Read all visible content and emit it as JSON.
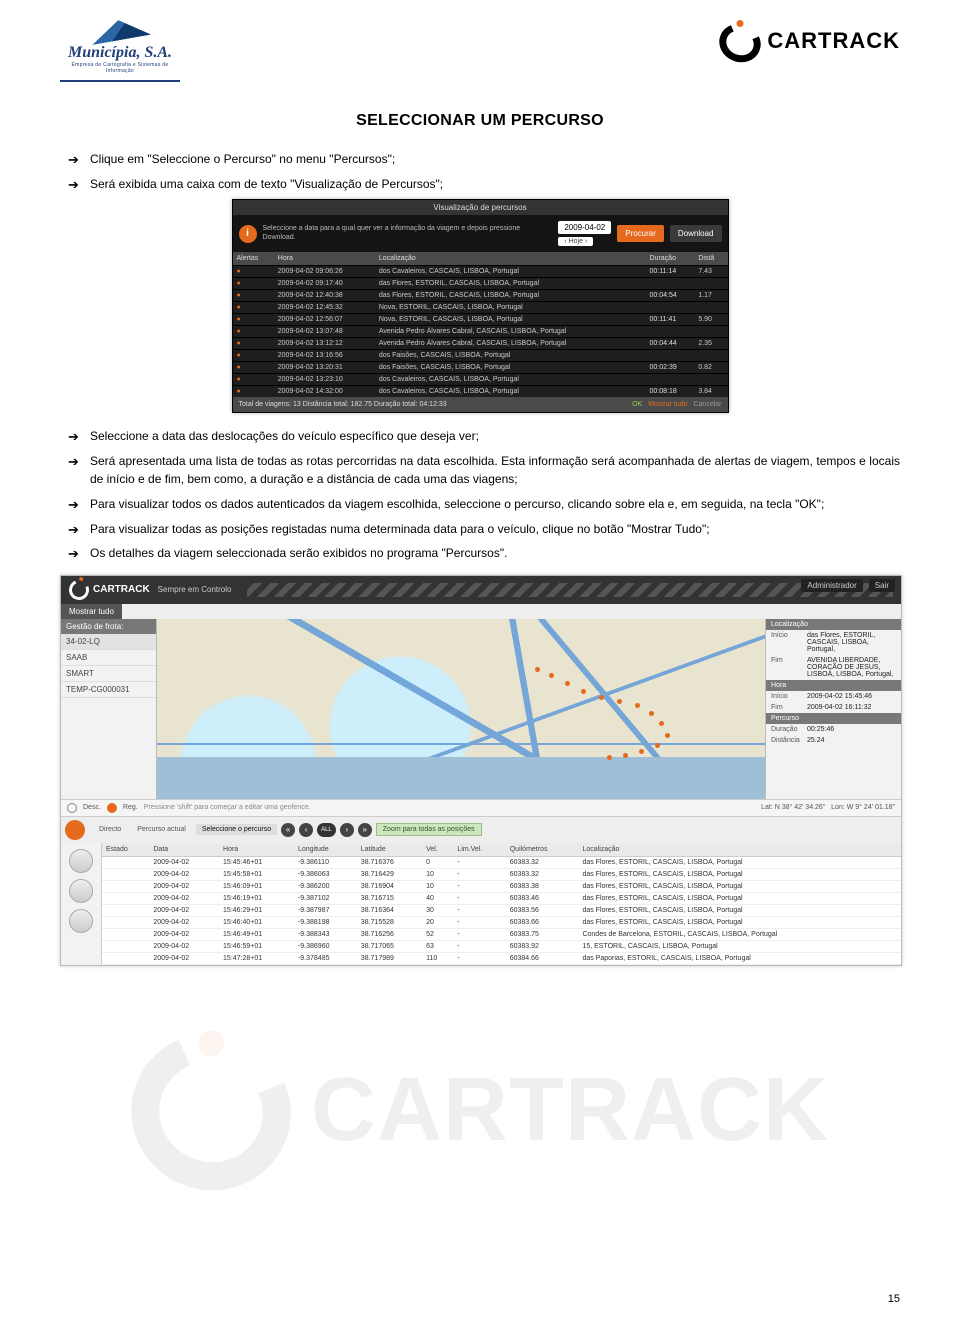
{
  "header": {
    "municipia_name": "Municípia, S.A.",
    "municipia_sub": "Empresa de Cartografia e Sistemas de Informação",
    "cartrack": "CARTRACK"
  },
  "title": "SELECCIONAR UM PERCURSO",
  "bullets_a": [
    "Clique em \"Seleccione o Percurso\" no menu \"Percursos\";",
    "Será exibida uma caixa com de texto \"Visualização de Percursos\";"
  ],
  "bullets_b": [
    "Seleccione a data das deslocações do veículo específico que deseja ver;",
    "Será apresentada uma lista de todas as rotas percorridas na data escolhida. Esta informação será acompanhada de alertas de viagem, tempos e locais de início e de fim, bem como, a duração e a distância de cada uma das viagens;",
    "Para visualizar todos os dados autenticados da viagem escolhida, seleccione o percurso, clicando sobre ela e, em seguida, na tecla \"OK\";",
    "Para visualizar todas as posições registadas numa determinada data para o veículo, clique no botão \"Mostrar Tudo\";",
    "Os detalhes da viagem seleccionada serão exibidos no programa \"Percursos\"."
  ],
  "shot1": {
    "title": "Visualização de percursos",
    "hint": "Seleccione a data para a qual quer ver a informação da viagem e depois pressione Download.",
    "date": "2009-04-02",
    "hoje": "‹ Hoje ›",
    "procurar": "Procurar",
    "download": "Download",
    "cols": [
      "Alertas",
      "Hora",
      "Localização",
      "Duração",
      "Distâ"
    ],
    "rows": [
      {
        "h": "2009-04-02 09:06:26",
        "l": "dos Cavaleiros, CASCAIS, LISBOA, Portugal",
        "d": "00:11:14",
        "k": "7.43"
      },
      {
        "h": "2009-04-02 09:17:40",
        "l": "das Flores, ESTORIL, CASCAIS, LISBOA, Portugal",
        "d": "",
        "k": ""
      },
      {
        "h": "2009-04-02 12:40:38",
        "l": "das Flores, ESTORIL, CASCAIS, LISBOA, Portugal",
        "d": "00:04:54",
        "k": "1.17"
      },
      {
        "h": "2009-04-02 12:45:32",
        "l": "Nova, ESTORIL, CASCAIS, LISBOA, Portugal",
        "d": "",
        "k": ""
      },
      {
        "h": "2009-04-02 12:56:07",
        "l": "Nova, ESTORIL, CASCAIS, LISBOA, Portugal",
        "d": "00:11:41",
        "k": "5.90"
      },
      {
        "h": "2009-04-02 13:07:48",
        "l": "Avenida Pedro Álvares Cabral, CASCAIS, LISBOA, Portugal",
        "d": "",
        "k": ""
      },
      {
        "h": "2009-04-02 13:12:12",
        "l": "Avenida Pedro Álvares Cabral, CASCAIS, LISBOA, Portugal",
        "d": "00:04:44",
        "k": "2.35"
      },
      {
        "h": "2009-04-02 13:16:56",
        "l": "dos Faisões, CASCAIS, LISBOA, Portugal",
        "d": "",
        "k": ""
      },
      {
        "h": "2009-04-02 13:20:31",
        "l": "dos Faisões, CASCAIS, LISBOA, Portugal",
        "d": "00:02:39",
        "k": "0.82"
      },
      {
        "h": "2009-04-02 13:23:10",
        "l": "dos Cavaleiros, CASCAIS, LISBOA, Portugal",
        "d": "",
        "k": ""
      },
      {
        "h": "2009-04-02 14:32:00",
        "l": "dos Cavaleiros, CASCAIS, LISBOA, Portugal",
        "d": "00:08:18",
        "k": "3.84"
      }
    ],
    "footer_left": "Total de viagens:  13   Distância total:   182.75   Duração total:   04:12:33",
    "ok": "OK",
    "mostrar": "Mostrar tudo",
    "cancel": "Cancelar"
  },
  "shot2": {
    "brand": "CARTRACK",
    "slogan": "Sempre em Controlo",
    "admin": "Administrador",
    "sair": "Sair",
    "mostrar_tudo": "Mostrar tudo",
    "sidebar_header": "Gestão de frota:",
    "sidebar_items": [
      "34-02-LQ",
      "SAAB",
      "SMART",
      "TEMP-CG000031"
    ],
    "rp_loc": "Localização",
    "rp_inicio": "Início",
    "rp_inicio_v": "das Flores, ESTORIL, CASCAIS, LISBOA, Portugal,",
    "rp_fim": "Fim",
    "rp_fim_v": "AVENIDA LIBERDADE, CORAÇÃO DE JESUS, LISBOA, LISBOA, Portugal,",
    "rp_hora": "Hora",
    "rp_hini": "2009-04-02 15:45:46",
    "rp_hfim": "2009-04-02 16:11:32",
    "rp_perc": "Percurso",
    "rp_dur_k": "Duração",
    "rp_dur_v": "00:25:46",
    "rp_dis_k": "Distância",
    "rp_dis_v": "25.24",
    "status_desc": "Desc.",
    "status_reg": "Reg.",
    "status_hint": "Pressione 'shift' para começar a editar uma geofence.",
    "lat_lbl": "Lat:",
    "lat_v": "N 38° 42' 34.26\"",
    "lon_lbl": "Lon:",
    "lon_v": "W 9° 24' 01.18\"",
    "tab_directo": "Directo",
    "tab_actual": "Percurso actual",
    "tab_sel": "Seleccione o percurso",
    "nav_all": "ALL",
    "zoom": "Zoom para todas as posições",
    "grid_cols": [
      "Estado",
      "Data",
      "Hora",
      "Longitude",
      "Latitude",
      "Vel.",
      "Lim.Vel.",
      "Quilómetros",
      "Localização"
    ],
    "grid_rows": [
      {
        "d": "2009-04-02",
        "h": "15:45:46+01",
        "lon": "-9.386110",
        "lat": "38.716376",
        "v": "0",
        "lv": "-",
        "km": "60383.32",
        "loc": "das Flores, ESTORIL, CASCAIS, LISBOA, Portugal"
      },
      {
        "d": "2009-04-02",
        "h": "15:45:58+01",
        "lon": "-9.386063",
        "lat": "38.716429",
        "v": "10",
        "lv": "-",
        "km": "60383.32",
        "loc": "das Flores, ESTORIL, CASCAIS, LISBOA, Portugal"
      },
      {
        "d": "2009-04-02",
        "h": "15:46:09+01",
        "lon": "-9.386200",
        "lat": "38.716904",
        "v": "10",
        "lv": "-",
        "km": "60383.38",
        "loc": "das Flores, ESTORIL, CASCAIS, LISBOA, Portugal"
      },
      {
        "d": "2009-04-02",
        "h": "15:46:19+01",
        "lon": "-9.387102",
        "lat": "38.716715",
        "v": "40",
        "lv": "-",
        "km": "60383.46",
        "loc": "das Flores, ESTORIL, CASCAIS, LISBOA, Portugal"
      },
      {
        "d": "2009-04-02",
        "h": "15:46:29+01",
        "lon": "-9.387987",
        "lat": "38.716364",
        "v": "30",
        "lv": "-",
        "km": "60383.56",
        "loc": "das Flores, ESTORIL, CASCAIS, LISBOA, Portugal"
      },
      {
        "d": "2009-04-02",
        "h": "15:46:40+01",
        "lon": "-9.388198",
        "lat": "38.715528",
        "v": "20",
        "lv": "-",
        "km": "60383.66",
        "loc": "das Flores, ESTORIL, CASCAIS, LISBOA, Portugal"
      },
      {
        "d": "2009-04-02",
        "h": "15:46:49+01",
        "lon": "-9.388343",
        "lat": "38.716256",
        "v": "52",
        "lv": "-",
        "km": "60383.75",
        "loc": "Condes de Barcelona, ESTORIL, CASCAIS, LISBOA, Portugal"
      },
      {
        "d": "2009-04-02",
        "h": "15:46:59+01",
        "lon": "-9.386960",
        "lat": "38.717065",
        "v": "63",
        "lv": "-",
        "km": "60383.92",
        "loc": "15, ESTORIL, CASCAIS, LISBOA, Portugal"
      },
      {
        "d": "2009-04-02",
        "h": "15:47:28+01",
        "lon": "-9.378485",
        "lat": "38.717989",
        "v": "110",
        "lv": "-",
        "km": "60384.66",
        "loc": "das Paporias, ESTORIL, CASCAIS, LISBOA, Portugal"
      }
    ]
  },
  "page_number": "15"
}
